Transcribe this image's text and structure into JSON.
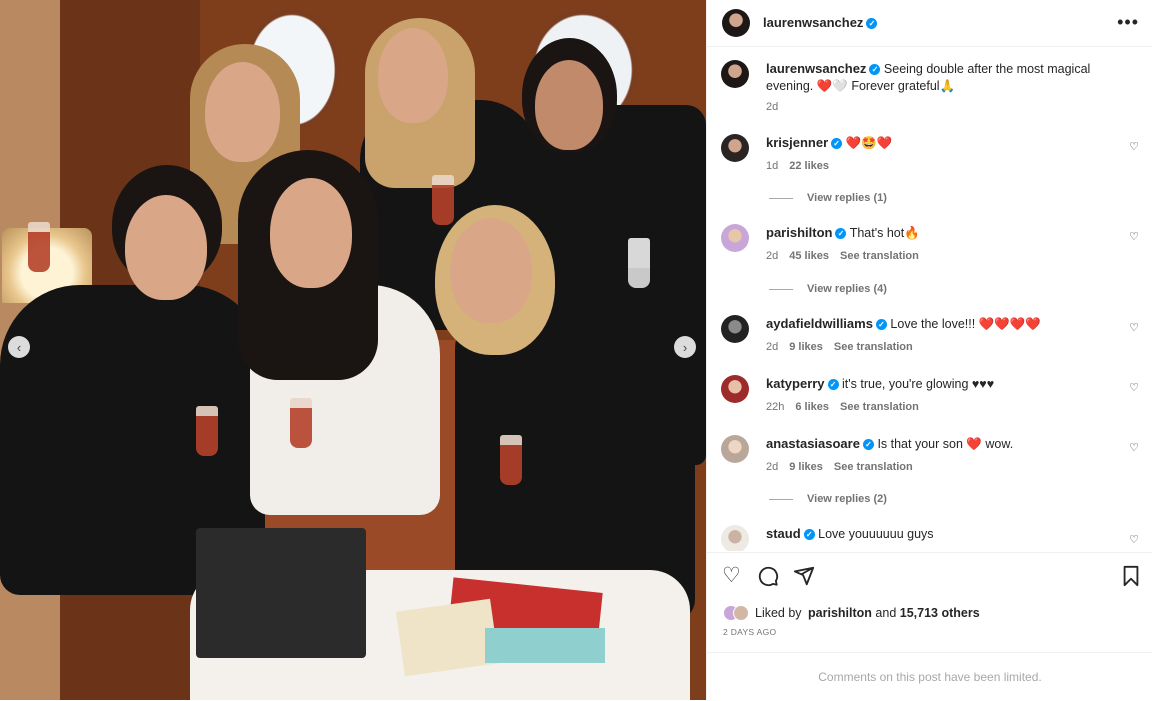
{
  "post": {
    "author": "laurenwsanchez",
    "caption_author": "laurenwsanchez",
    "caption": "Seeing double after the most magical evening. ❤️🤍 Forever grateful🙏",
    "caption_time": "2d"
  },
  "comments": [
    {
      "user": "krisjenner",
      "text": "❤️🤩❤️",
      "time": "1d",
      "likes": "22 likes",
      "translate": "",
      "replies": "View replies (1)",
      "verified": true,
      "avatar_color": "#2a2422"
    },
    {
      "user": "parishilton",
      "text": "That's hot🔥",
      "time": "2d",
      "likes": "45 likes",
      "translate": "See translation",
      "replies": "View replies (4)",
      "verified": true,
      "avatar_color": "#c9a6d8"
    },
    {
      "user": "aydafieldwilliams",
      "text": "Love the love!!! ❤️❤️❤️❤️",
      "time": "2d",
      "likes": "9 likes",
      "translate": "See translation",
      "replies": "",
      "verified": true,
      "avatar_color": "#222222"
    },
    {
      "user": "katyperry",
      "text": "it's true, you're glowing ♥♥♥",
      "time": "22h",
      "likes": "6 likes",
      "translate": "See translation",
      "replies": "",
      "verified": true,
      "avatar_color": "#9e2b2b"
    },
    {
      "user": "anastasiasoare",
      "text": "Is that your son ❤️ wow.",
      "time": "2d",
      "likes": "9 likes",
      "translate": "See translation",
      "replies": "View replies (2)",
      "verified": true,
      "avatar_color": "#b9a79a"
    },
    {
      "user": "staud",
      "text": "Love youuuuuu guys",
      "verified": true,
      "avatar_color": "#d8cfc6"
    }
  ],
  "actions": {
    "like_icon": "heart-outline-icon",
    "comment_icon": "comment-bubble-icon",
    "share_icon": "paper-plane-icon",
    "save_icon": "bookmark-icon"
  },
  "liked_by": {
    "prefix": "Liked by ",
    "user": "parishilton",
    "middle": " and ",
    "count": "15,713 others"
  },
  "post_date": "2 DAYS AGO",
  "limited_notice": "Comments on this post have been limited.",
  "carousel": {
    "prev": "‹",
    "next": "›"
  },
  "colors": {
    "verified": "#0095f6",
    "text": "#262626",
    "secondary": "#737373",
    "border": "#efefef"
  }
}
